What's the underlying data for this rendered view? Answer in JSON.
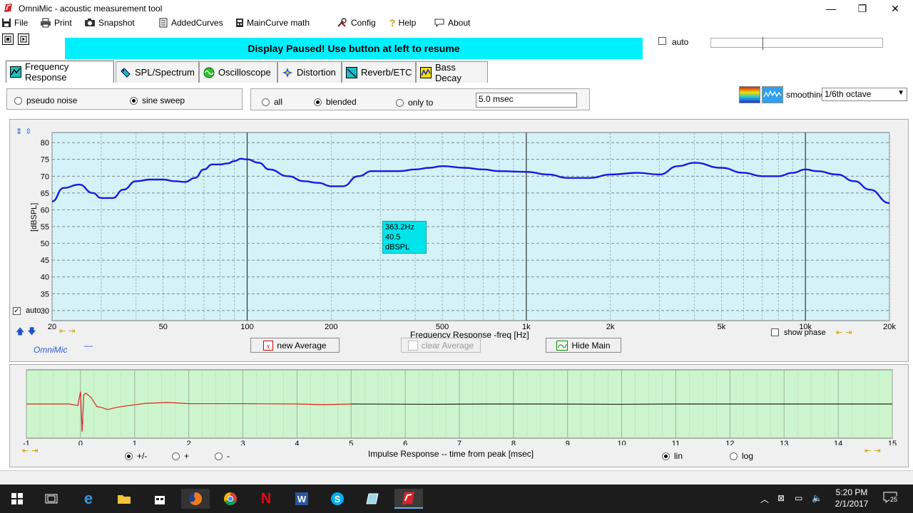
{
  "window": {
    "title": "OmniMic - acoustic measurement tool",
    "minimize": "—",
    "restore": "❐",
    "close": "✕"
  },
  "menu": {
    "file": "File",
    "print": "Print",
    "snapshot": "Snapshot",
    "added_curves": "AddedCurves",
    "main_curve_math": "MainCurve math",
    "config": "Config",
    "help": "Help",
    "about": "About"
  },
  "banner": {
    "text": "Display Paused! Use button at left to resume"
  },
  "top_controls": {
    "auto_label": "auto",
    "auto_checked": false,
    "slider_position": 0.3
  },
  "tabs": [
    {
      "label": "Frequency Response",
      "active": true
    },
    {
      "label": "SPL/Spectrum"
    },
    {
      "label": "Oscilloscope"
    },
    {
      "label": "Distortion"
    },
    {
      "label": "Reverb/ETC"
    },
    {
      "label": "Bass Decay"
    }
  ],
  "signal": {
    "pseudo_noise": "pseudo noise",
    "sine_sweep": "sine sweep",
    "selected": "sine sweep"
  },
  "window_mode": {
    "all": "all",
    "blended": "blended",
    "only_to": "only to",
    "selected": "blended",
    "msec_value": "5.0 msec"
  },
  "smoothing": {
    "label": "smoothing",
    "value": "1/6th octave"
  },
  "colors": {
    "curve": "#1a1ae0",
    "impulse_red": "#e02020",
    "impulse_black": "#222222",
    "plot_bg": "#d4f2f7",
    "impulse_bg": "#cdf5cd",
    "banner": "#00f0ff"
  },
  "freq_chart": {
    "type": "line",
    "xlabel": "Frequency Response -freq [Hz]",
    "ylabel": "[dBSPL]",
    "x_scale": "log",
    "xlim": [
      20,
      20000
    ],
    "ylim": [
      27,
      83
    ],
    "x_ticks": [
      {
        "v": 20,
        "label": "20"
      },
      {
        "v": 50,
        "label": "50"
      },
      {
        "v": 100,
        "label": "100"
      },
      {
        "v": 200,
        "label": "200"
      },
      {
        "v": 500,
        "label": "500"
      },
      {
        "v": 1000,
        "label": "1k"
      },
      {
        "v": 2000,
        "label": "2k"
      },
      {
        "v": 5000,
        "label": "5k"
      },
      {
        "v": 10000,
        "label": "10k"
      },
      {
        "v": 20000,
        "label": "20k"
      }
    ],
    "y_ticks": [
      30,
      35,
      40,
      45,
      50,
      55,
      60,
      65,
      70,
      75,
      80
    ],
    "grid": true,
    "series": [
      {
        "x": [
          20,
          22,
          25,
          28,
          30,
          33,
          36,
          40,
          45,
          50,
          55,
          60,
          65,
          70,
          75,
          80,
          85,
          90,
          95,
          100,
          110,
          120,
          140,
          160,
          180,
          200,
          220,
          250,
          280,
          300,
          350,
          400,
          450,
          500,
          600,
          700,
          800,
          1000,
          1200,
          1400,
          1700,
          2000,
          2500,
          3000,
          3500,
          4000,
          5000,
          6000,
          7000,
          8000,
          9000,
          10000,
          11000,
          13000,
          15000,
          17000,
          20000
        ],
        "y": [
          62.5,
          66.5,
          67.5,
          65,
          63.5,
          63.5,
          66,
          68.5,
          69,
          69,
          68.5,
          68.3,
          69.5,
          72,
          73.5,
          73.5,
          73.8,
          74.5,
          75.2,
          75,
          74,
          72,
          70,
          68.5,
          68,
          67,
          67,
          70,
          71.5,
          71.5,
          71.5,
          72,
          72.5,
          73,
          72.5,
          72,
          71.5,
          71.3,
          70.5,
          69.5,
          69.5,
          70.5,
          71,
          70.5,
          73,
          74,
          72.5,
          71,
          70,
          70,
          71,
          72,
          71.5,
          70.5,
          68.5,
          66,
          62
        ]
      }
    ]
  },
  "freq_controls": {
    "auto_label": "auto",
    "auto_checked": true,
    "show_phase": "show phase",
    "brand": "OmniMic",
    "new_average": "new Average",
    "clear_average": "clear Average",
    "hide_main": "Hide Main",
    "tooltip_freq": "363.2Hz",
    "tooltip_level": "40.5 dBSPL"
  },
  "impulse_chart": {
    "type": "line",
    "xlabel": "Impulse Response  -- time from peak [msec]",
    "xlim": [
      -1,
      15
    ],
    "x_ticks": [
      -1,
      0,
      1,
      2,
      3,
      4,
      5,
      6,
      7,
      8,
      9,
      10,
      11,
      12,
      13,
      14,
      15
    ],
    "ylim": [
      -1,
      1
    ],
    "red_until": 5,
    "series": [
      {
        "x": [
          -1,
          -0.2,
          -0.05,
          0,
          0.03,
          0.06,
          0.1,
          0.15,
          0.2,
          0.3,
          0.4,
          0.5,
          0.7,
          0.9,
          1.2,
          1.6,
          2.0,
          3.0,
          4.0,
          4.5,
          5,
          6.5,
          7.5,
          8.5,
          10,
          11,
          12,
          13,
          14,
          15
        ],
        "y": [
          0,
          0,
          -0.05,
          0.4,
          -0.9,
          0.3,
          0.35,
          0.28,
          0.2,
          -0.08,
          -0.12,
          -0.18,
          -0.1,
          -0.05,
          0.02,
          0.05,
          0.01,
          0.01,
          0.0,
          -0.02,
          0.0,
          -0.01,
          0.0,
          0.0,
          -0.01,
          0.0,
          0.0,
          0.0,
          0.0,
          0
        ]
      }
    ]
  },
  "impulse_controls": {
    "polarity_both": "+/-",
    "polarity_pos": "+",
    "polarity_neg": "-",
    "polarity_selected": "+/-",
    "lin": "lin",
    "log": "log",
    "scale_selected": "lin"
  },
  "taskbar": {
    "time": "5:20 PM",
    "date": "2/1/2017",
    "notifications": "25"
  }
}
